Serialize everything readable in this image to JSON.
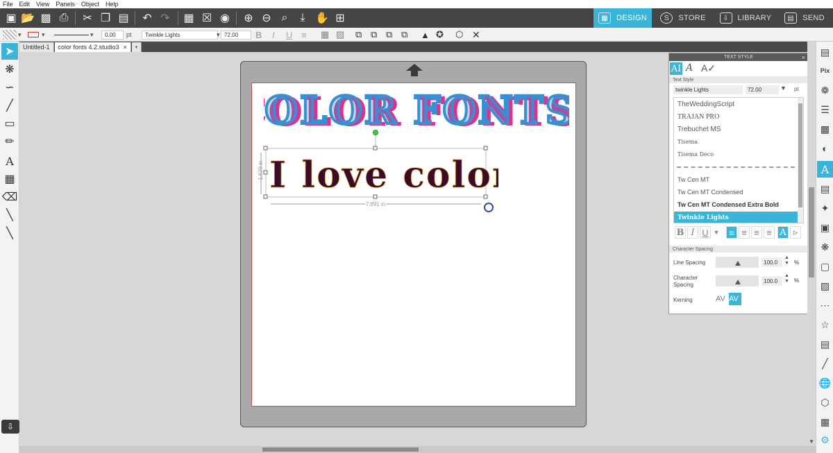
{
  "menu": [
    "File",
    "Edit",
    "View",
    "Panels",
    "Object",
    "Help"
  ],
  "modes": [
    {
      "label": "DESIGN",
      "icon": "grid-icon"
    },
    {
      "label": "STORE",
      "icon": "store-icon"
    },
    {
      "label": "LIBRARY",
      "icon": "library-icon"
    },
    {
      "label": "SEND",
      "icon": "send-icon"
    }
  ],
  "propbar": {
    "line_width": "0.00",
    "line_unit": "pt",
    "font": "Twinkle Lights",
    "size": "72.00"
  },
  "doc_tabs": [
    "Untitled-1",
    "color fonts 4.2.studio3"
  ],
  "canvas": {
    "title_text": "COLOR FONTS!",
    "selected_text": "I love color",
    "width_label": "7.891 in",
    "height_label": "1.629 in"
  },
  "panel": {
    "title": "TEXT STYLE",
    "section_text_style": "Text Style",
    "font_value": "twinkle Lights",
    "size_value": "72.00",
    "size_unit": "pt",
    "fonts": [
      "TheWeddingScript",
      "TRAJAN PRO",
      "Trebuchet MS",
      "Tisema",
      "Tisema Deco",
      "",
      "Tw Cen MT",
      "Tw Cen MT Condensed",
      "Tw Cen MT Condensed Extra Bold",
      "Twinkle Lights"
    ],
    "selected_font_index": 9,
    "section_char_spacing": "Character Spacing",
    "line_spacing_label": "Line Spacing",
    "line_spacing_value": "100.0",
    "char_spacing_label": "Character Spacing",
    "char_spacing_value": "100.0",
    "percent": "%",
    "kerning_label": "Kerning",
    "kerning_glyph": "AV"
  },
  "colors": {
    "accent": "#3ab4d8",
    "toolbar": "#454545",
    "title_pink": "#e0308e",
    "title_blue": "#3a8fd0",
    "love_fill": "#3a0a2a"
  }
}
